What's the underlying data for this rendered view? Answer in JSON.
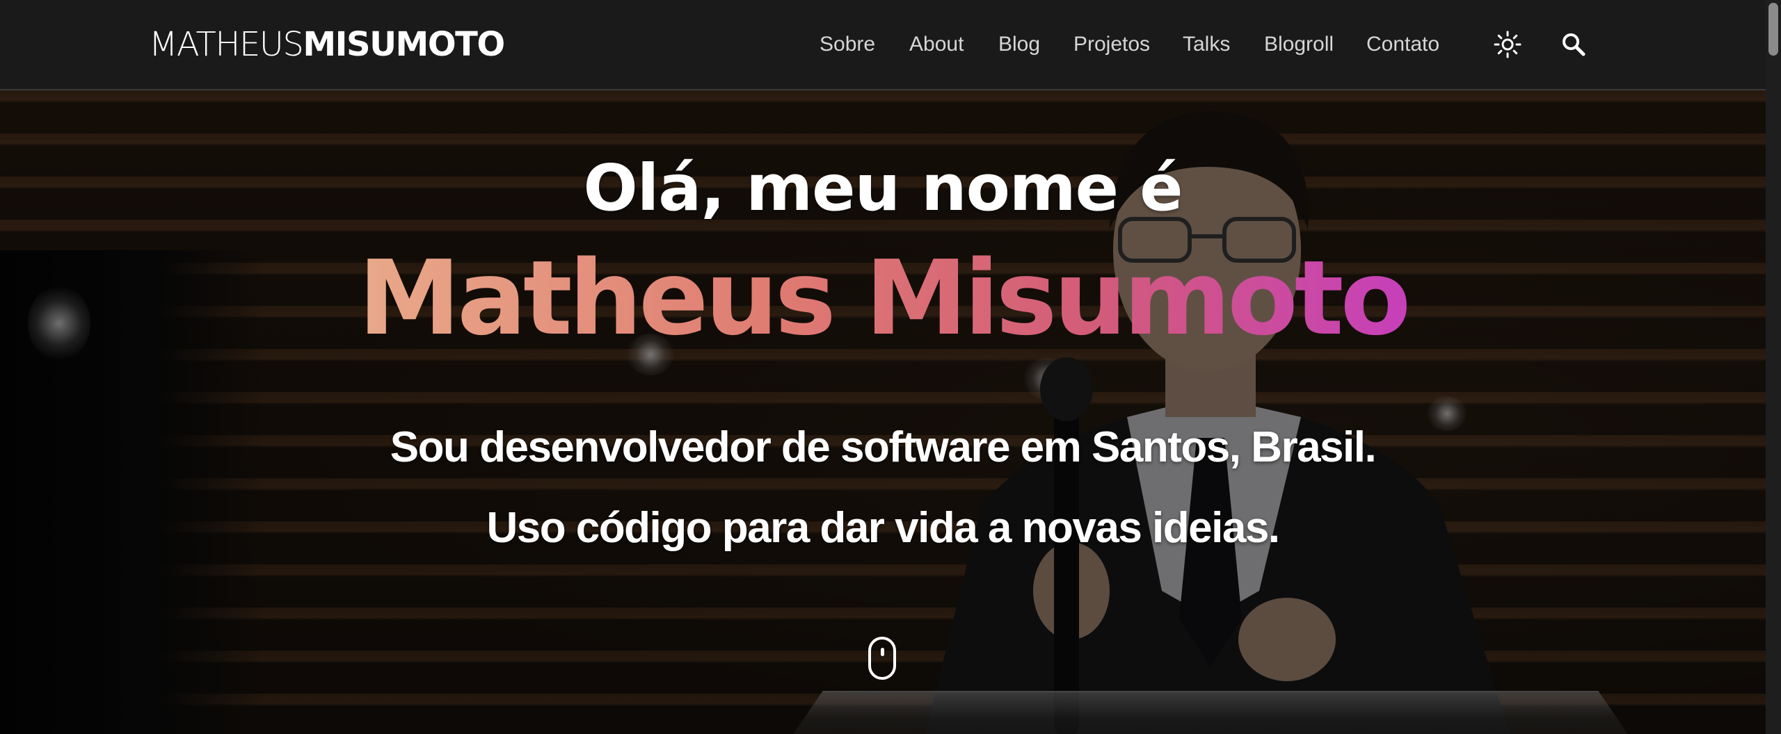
{
  "header": {
    "logo_light": "MATHEUS",
    "logo_bold": "MISUMOTO",
    "nav": [
      {
        "label": "Sobre"
      },
      {
        "label": "About"
      },
      {
        "label": "Blog"
      },
      {
        "label": "Projetos"
      },
      {
        "label": "Talks"
      },
      {
        "label": "Blogroll"
      },
      {
        "label": "Contato"
      }
    ],
    "icons": {
      "theme_toggle": "sun-icon",
      "search": "search-icon"
    }
  },
  "hero": {
    "greeting": "Olá, meu nome é",
    "name": "Matheus Misumoto",
    "tagline_1": "Sou desenvolvedor de software em Santos, Brasil.",
    "tagline_2": "Uso código para dar vida a novas ideias.",
    "scroll_icon": "mouse-scroll-icon"
  },
  "colors": {
    "header_bg": "#1a1a1b",
    "nav_text": "#d6d6d6",
    "name_gradient_start": "#e9a989",
    "name_gradient_end": "#c63fba"
  }
}
